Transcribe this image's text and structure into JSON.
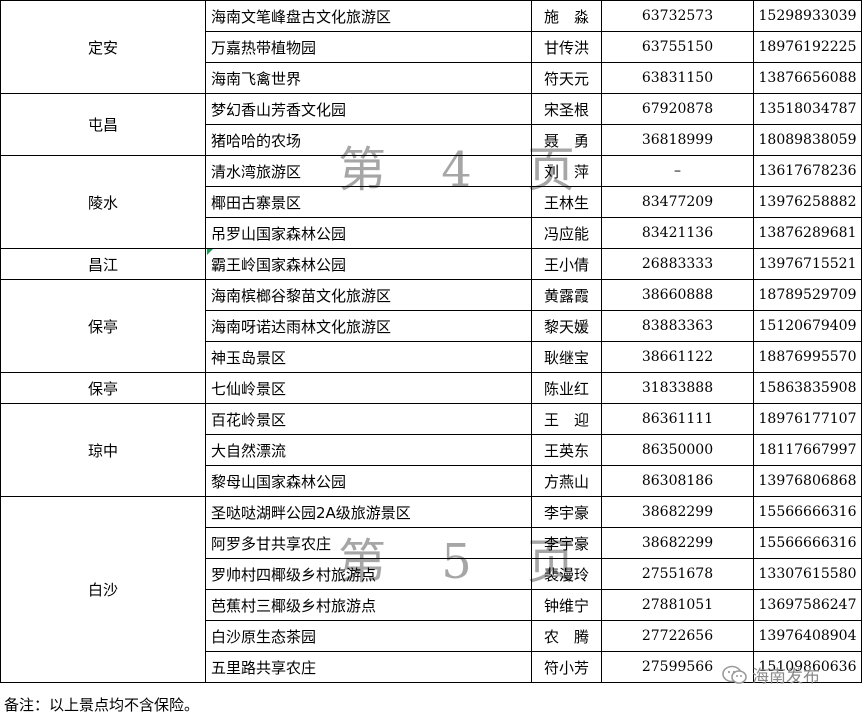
{
  "rows": [
    {
      "region": "定安",
      "span": 3,
      "name": "海南文笔峰盘古文化旅游区",
      "contact": "施　淼",
      "phone": "63732573",
      "mobile": "15298933039"
    },
    {
      "name": "万嘉热带植物园",
      "contact": "甘传洪",
      "phone": "63755150",
      "mobile": "18976192225"
    },
    {
      "name": "海南飞禽世界",
      "contact": "符天元",
      "phone": "63831150",
      "mobile": "13876656088"
    },
    {
      "region": "屯昌",
      "span": 2,
      "name": "梦幻香山芳香文化园",
      "contact": "宋圣根",
      "phone": "67920878",
      "mobile": "13518034787"
    },
    {
      "name": "猪哈哈的农场",
      "contact": "聂　勇",
      "phone": "36818999",
      "mobile": "18089838059"
    },
    {
      "region": "陵水",
      "span": 3,
      "name": "清水湾旅游区",
      "contact": "刘　萍",
      "phone": "–",
      "mobile": "13617678236"
    },
    {
      "name": "椰田古寨景区",
      "contact": "王林生",
      "phone": "83477209",
      "mobile": "13976258882"
    },
    {
      "name": "吊罗山国家森林公园",
      "contact": "冯应能",
      "phone": "83421136",
      "mobile": "13876289681"
    },
    {
      "region": "昌江",
      "span": 1,
      "name": "霸王岭国家森林公园",
      "contact": "王小倩",
      "phone": "26883333",
      "mobile": "13976715521"
    },
    {
      "region": "保亭",
      "span": 3,
      "name": "海南槟榔谷黎苗文化旅游区",
      "contact": "黄露霞",
      "phone": "38660888",
      "mobile": "18789529709"
    },
    {
      "name": "海南呀诺达雨林文化旅游区",
      "contact": "黎天媛",
      "phone": "83883363",
      "mobile": "15120679409"
    },
    {
      "name": "神玉岛景区",
      "contact": "耿继宝",
      "phone": "38661122",
      "mobile": "18876995570"
    },
    {
      "region": "保亭",
      "span": 1,
      "name": "七仙岭景区",
      "contact": "陈业红",
      "phone": "31833888",
      "mobile": "15863835908"
    },
    {
      "region": "琼中",
      "span": 3,
      "name": "百花岭景区",
      "contact": "王　迎",
      "phone": "86361111",
      "mobile": "18976177107"
    },
    {
      "name": "大自然漂流",
      "contact": "王英东",
      "phone": "86350000",
      "mobile": "18117667997"
    },
    {
      "name": "黎母山国家森林公园",
      "contact": "方燕山",
      "phone": "86308186",
      "mobile": "13976806868"
    },
    {
      "region": "白沙",
      "span": 6,
      "name": "圣哒哒湖畔公园2A级旅游景区",
      "contact": "李宇豪",
      "phone": "38682299",
      "mobile": "15566666316"
    },
    {
      "name": "阿罗多甘共享农庄",
      "contact": "李宇豪",
      "phone": "38682299",
      "mobile": "15566666316"
    },
    {
      "name": "罗帅村四椰级乡村旅游点",
      "contact": "裴漫玲",
      "phone": "27551678",
      "mobile": "13307615580"
    },
    {
      "name": "芭蕉村三椰级乡村旅游点",
      "contact": "钟维宁",
      "phone": "27881051",
      "mobile": "13697586247"
    },
    {
      "name": "白沙原生态茶园",
      "contact": "农　腾",
      "phone": "27722656",
      "mobile": "13976408904"
    },
    {
      "name": "五里路共享农庄",
      "contact": "符小芳",
      "phone": "27599566",
      "mobile": "15109860636"
    }
  ],
  "watermarks": [
    "第 4 页",
    "第 5 页"
  ],
  "footer_note": "备注：以上景点均不含保险。",
  "brand": "海南发布"
}
